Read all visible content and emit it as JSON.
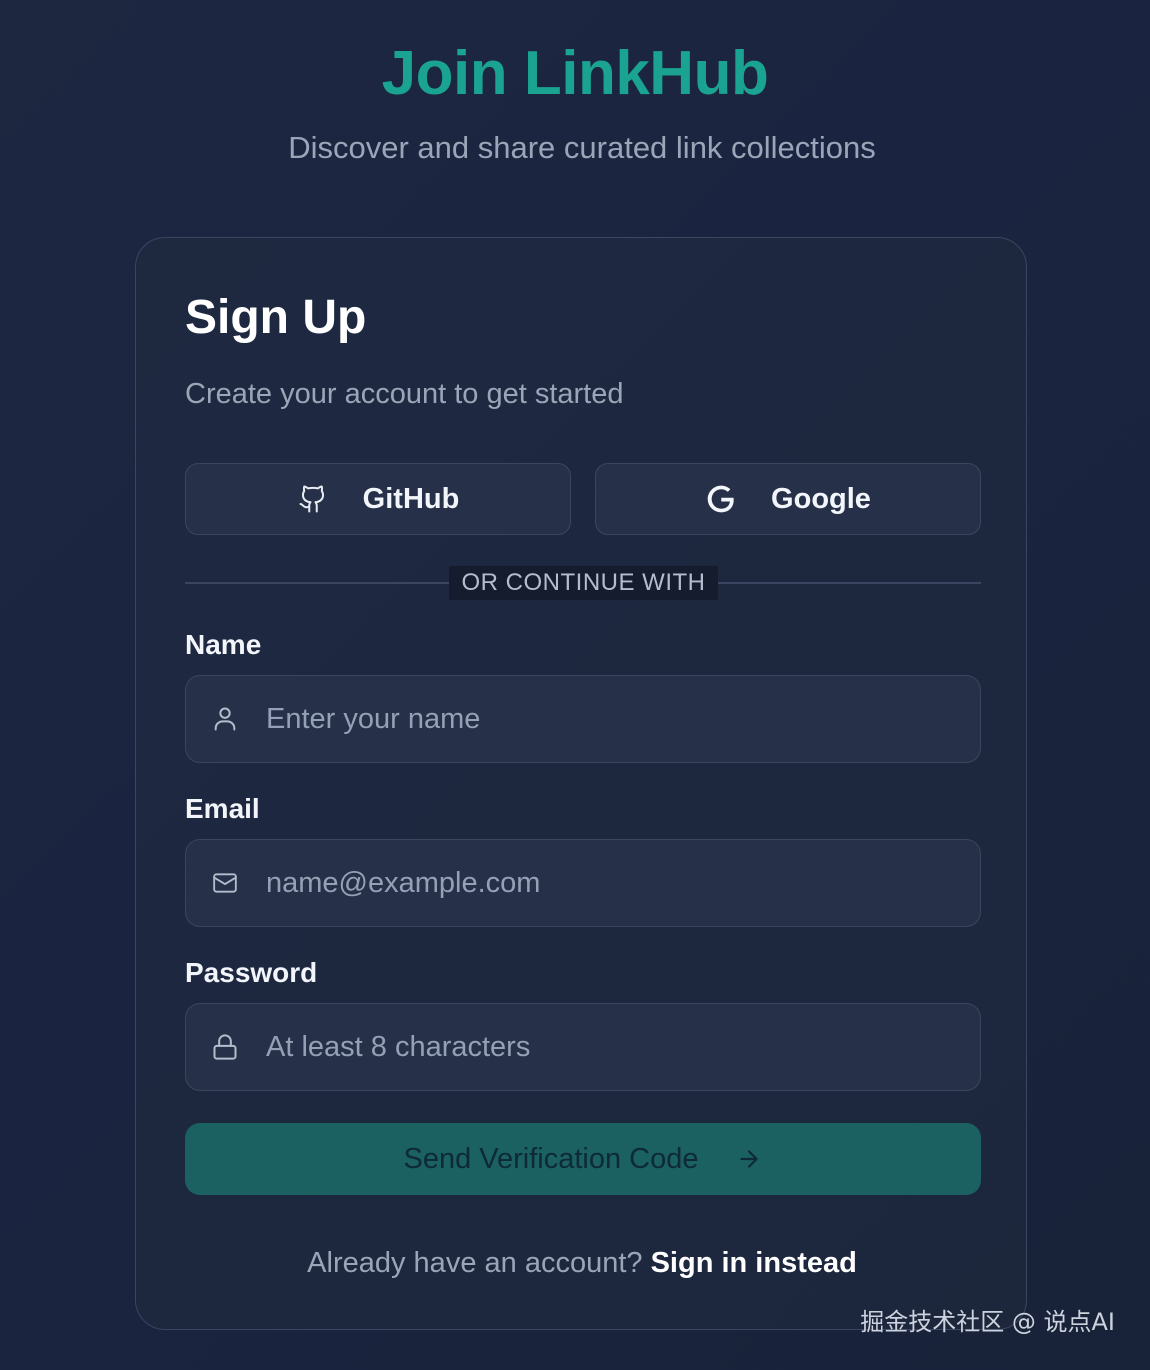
{
  "hero": {
    "title": "Join LinkHub",
    "subtitle": "Discover and share curated link collections"
  },
  "card": {
    "title": "Sign Up",
    "subtitle": "Create your account to get started"
  },
  "social": {
    "github": {
      "label": "GitHub",
      "icon": "github-icon"
    },
    "google": {
      "label": "Google",
      "icon": "google-icon"
    }
  },
  "divider": {
    "text": "OR CONTINUE WITH"
  },
  "fields": {
    "name": {
      "label": "Name",
      "placeholder": "Enter your name",
      "value": "",
      "icon": "user-icon"
    },
    "email": {
      "label": "Email",
      "placeholder": "name@example.com",
      "value": "",
      "icon": "mail-icon"
    },
    "password": {
      "label": "Password",
      "placeholder": "At least 8 characters",
      "value": "",
      "icon": "lock-icon"
    }
  },
  "submit": {
    "label": "Send Verification Code",
    "icon": "arrow-right-icon"
  },
  "footer": {
    "prompt": "Already have an account?",
    "link": "Sign in instead"
  },
  "watermark": {
    "text": "掘金技术社区 @ 说点AI"
  },
  "colors": {
    "accent": "#1aa391",
    "submit_bg": "#1b6162",
    "background": "#1a2440",
    "card_border": "#3a4560",
    "field_bg": "#263149"
  }
}
